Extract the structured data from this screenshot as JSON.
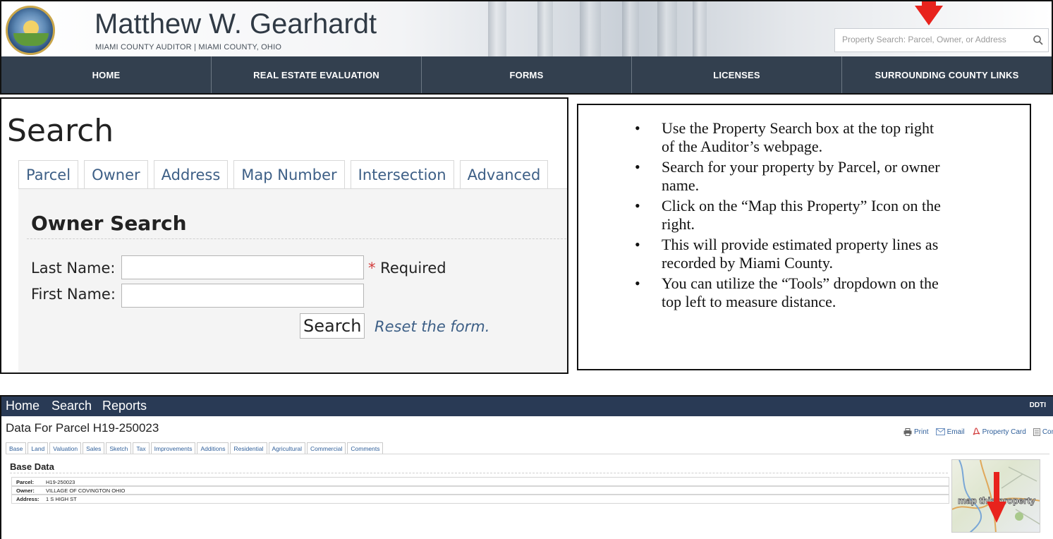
{
  "header": {
    "auditor_name": "Matthew W. Gearhardt",
    "subtitle": "MIAMI COUNTY AUDITOR | MIAMI COUNTY, OHIO",
    "search_placeholder": "Property Search: Parcel, Owner, or Address",
    "nav": [
      "HOME",
      "REAL ESTATE EVALUATION",
      "FORMS",
      "LICENSES",
      "SURROUNDING COUNTY LINKS"
    ]
  },
  "search_panel": {
    "title": "Search",
    "tabs": [
      "Parcel",
      "Owner",
      "Address",
      "Map Number",
      "Intersection",
      "Advanced"
    ],
    "active_tab": "Owner",
    "form_title": "Owner Search",
    "last_name_label": "Last Name:",
    "first_name_label": "First Name:",
    "required_star": "*",
    "required_text": " Required",
    "search_button": "Search",
    "reset_link": "Reset the form.",
    "last_name_value": "",
    "first_name_value": ""
  },
  "instructions": [
    "Use the Property Search box at the top right of the Auditor’s webpage.",
    "Search for your property by Parcel, or owner name.",
    "Click on the “Map this Property” Icon on the right.",
    "This will provide estimated property lines as recorded by Miami County.",
    "You can utilize the “Tools” dropdown on the top left to measure distance."
  ],
  "parcel_page": {
    "nav": [
      "Home",
      "Search",
      "Reports"
    ],
    "vendor": "DDTI",
    "title": "Data For Parcel H19-250023",
    "actions": [
      "Print",
      "Email",
      "Property Card",
      "Comparables"
    ],
    "tabs": [
      "Base",
      "Land",
      "Valuation",
      "Sales",
      "Sketch",
      "Tax",
      "Improvements",
      "Additions",
      "Residential",
      "Agricultural",
      "Commercial",
      "Comments"
    ],
    "section_title": "Base Data",
    "rows": [
      {
        "key": "Parcel:",
        "value": "H19-250023"
      },
      {
        "key": "Owner:",
        "value": "VILLAGE OF COVINGTON OHIO"
      },
      {
        "key": "Address:",
        "value": "1 S HIGH ST"
      }
    ],
    "map_label": "map this property"
  },
  "colors": {
    "nav_bg": "#33404f",
    "parcel_nav_bg": "#293a55",
    "link_blue": "#3d5f86",
    "arrow_red": "#e8231d"
  }
}
